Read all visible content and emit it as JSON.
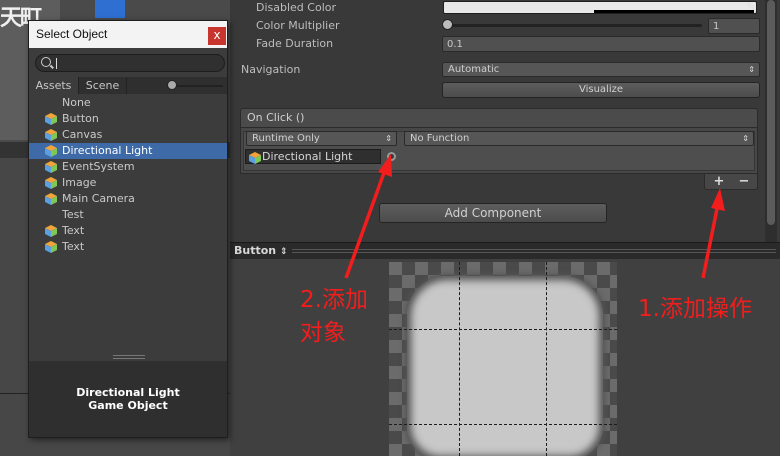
{
  "inspector": {
    "disabled_color_label": "Disabled Color",
    "color_multiplier_label": "Color Multiplier",
    "color_multiplier_value": "1",
    "color_multiplier_fraction": 0.0,
    "fade_duration_label": "Fade Duration",
    "fade_duration_value": "0.1",
    "navigation_label": "Navigation",
    "navigation_value": "Automatic",
    "visualize_label": "Visualize",
    "on_click_label": "On Click ()",
    "runtime_value": "Runtime Only",
    "function_value": "No Function",
    "target_object": "Directional Light",
    "plus_label": "+",
    "minus_label": "−",
    "add_component_label": "Add Component"
  },
  "preview": {
    "title": "Button",
    "dropdown_arrow": "⇕"
  },
  "select_object": {
    "title": "Select Object",
    "close_label": "x",
    "search_value": "",
    "tabs": [
      {
        "label": "Assets"
      },
      {
        "label": "Scene"
      }
    ],
    "items": [
      {
        "label": "None",
        "icon": ""
      },
      {
        "label": "Button",
        "icon": "gameobject-cube-icon"
      },
      {
        "label": "Canvas",
        "icon": "gameobject-cube-icon"
      },
      {
        "label": "Directional Light",
        "icon": "gameobject-cube-icon",
        "selected": true
      },
      {
        "label": "EventSystem",
        "icon": "gameobject-cube-icon"
      },
      {
        "label": "Image",
        "icon": "gameobject-cube-icon"
      },
      {
        "label": "Main Camera",
        "icon": "gameobject-cube-icon"
      },
      {
        "label": "Test",
        "icon": ""
      },
      {
        "label": "Text",
        "icon": "gameobject-cube-icon"
      },
      {
        "label": "Text",
        "icon": "gameobject-cube-icon"
      }
    ],
    "info_name": "Directional Light",
    "info_type": "Game Object"
  },
  "annotations": {
    "step1": "1.添加操作",
    "step2_line1": "2.添加",
    "step2_line2": "对象"
  },
  "colors": {
    "annotation_red": "#f21d1d",
    "selection_blue": "#3e6aa8",
    "close_red": "#c8352f"
  }
}
